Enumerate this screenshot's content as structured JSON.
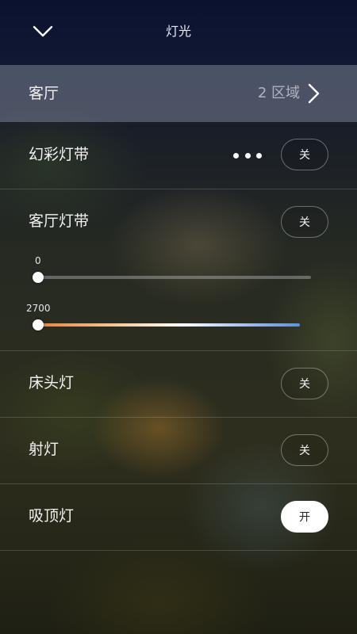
{
  "header": {
    "title": "灯光",
    "back_icon": "chevron-down-icon"
  },
  "zone": {
    "label": "客厅",
    "count": "2 区域",
    "chevron_icon": "chevron-right-icon"
  },
  "lights": [
    {
      "name": "幻彩灯带",
      "state": "关",
      "has_more": true,
      "more_icon": "more-dots-icon"
    },
    {
      "name": "客厅灯带",
      "state": "关",
      "brightness": {
        "value": "0",
        "level_fraction": 0.0
      },
      "color_temp": {
        "value": "2700",
        "level_fraction": 0.0,
        "gradient": [
          "#e8823a",
          "#ffffff",
          "#5e8ee0"
        ]
      }
    },
    {
      "name": "床头灯",
      "state": "关"
    },
    {
      "name": "射灯",
      "state": "关"
    },
    {
      "name": "吸顶灯",
      "state": "开"
    }
  ],
  "colors": {
    "on_toggle_bg": "#ffffff",
    "header_bg": "#0a1230",
    "zone_bg": "#7a8296"
  }
}
